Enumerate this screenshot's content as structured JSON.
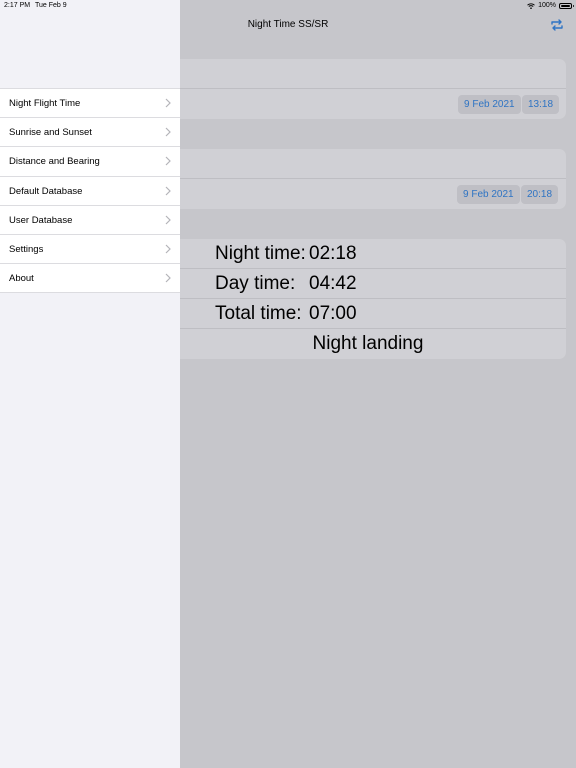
{
  "status_bar": {
    "time": "2:17 PM",
    "date": "Tue Feb 9",
    "battery": "100%"
  },
  "nav": {
    "title": "Night Time SS/SR",
    "right_icon": "refresh-icon"
  },
  "departure": {
    "date": "9 Feb 2021",
    "time": "13:18"
  },
  "arrival": {
    "date": "9 Feb 2021",
    "time": "20:18"
  },
  "results": {
    "night_label": "Night time:",
    "night_value": "02:18",
    "day_label": "Day time:",
    "day_value": "04:42",
    "total_label": "Total time:",
    "total_value": "07:00",
    "landing": "Night landing"
  },
  "sidebar": {
    "items": [
      {
        "label": "Night Flight Time"
      },
      {
        "label": "Sunrise and Sunset"
      },
      {
        "label": "Distance and Bearing"
      },
      {
        "label": "Default Database"
      },
      {
        "label": "User Database"
      },
      {
        "label": "Settings"
      },
      {
        "label": "About"
      }
    ]
  },
  "colors": {
    "accent": "#2f74c4",
    "dim_background": "#c6c6cb",
    "sidebar_background": "#f2f2f7"
  }
}
